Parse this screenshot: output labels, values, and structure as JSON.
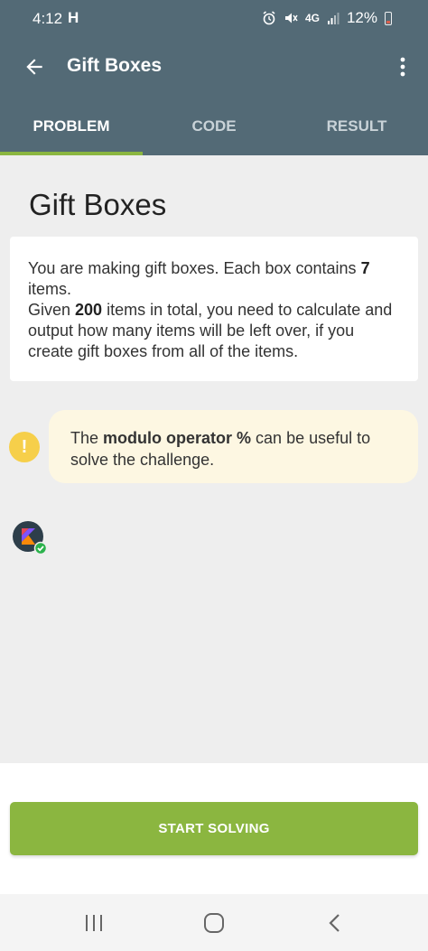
{
  "status_bar": {
    "time": "4:12",
    "carrier_icon": "H",
    "network": "4G",
    "battery_percent": "12%"
  },
  "app_bar": {
    "title": "Gift Boxes"
  },
  "tabs": [
    {
      "label": "PROBLEM",
      "active": true
    },
    {
      "label": "CODE",
      "active": false
    },
    {
      "label": "RESULT",
      "active": false
    }
  ],
  "problem": {
    "title": "Gift Boxes",
    "line1_a": "You are making gift boxes. Each box contains ",
    "line1_num": "7",
    "line1_b": " items.",
    "line2_a": "Given ",
    "line2_num": "200",
    "line2_b": " items in total, you need to calculate and output how many items will be left over, if you create gift boxes from all of the items."
  },
  "hint": {
    "pre": "The ",
    "bold": "modulo operator %",
    "post": " can be useful to solve the challenge."
  },
  "actions": {
    "start_label": "START SOLVING"
  },
  "colors": {
    "header": "#536a76",
    "accent_green": "#8bb640",
    "hint_yellow": "#f6cf4a",
    "hint_bg": "#fdf7e2"
  },
  "icons": {
    "back": "arrow-left-icon",
    "more": "more-vert-icon",
    "hint": "exclamation-icon",
    "language": "kotlin-icon"
  }
}
